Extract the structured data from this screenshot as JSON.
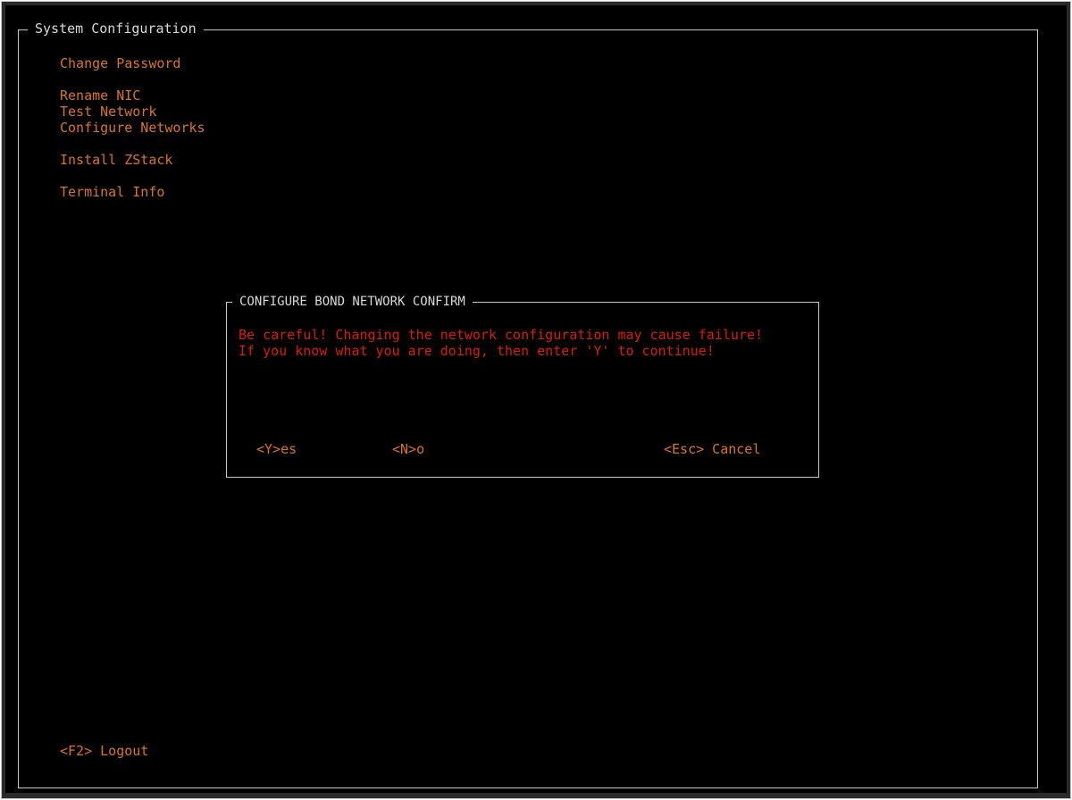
{
  "main": {
    "title": "System Configuration",
    "menu": {
      "change_password": "Change Password",
      "rename_nic": "Rename NIC",
      "test_network": "Test Network",
      "configure_networks": "Configure Networks",
      "install_zstack": "Install ZStack",
      "terminal_info": "Terminal Info"
    },
    "logout": "<F2> Logout"
  },
  "dialog": {
    "title": "CONFIGURE BOND NETWORK CONFIRM",
    "message_line1": "Be careful! Changing the network configuration may cause failure!",
    "message_line2": "If you know what you are doing, then enter 'Y' to continue!",
    "yes_label": "<Y>es",
    "no_label": "<N>o",
    "cancel_label": "<Esc> Cancel"
  },
  "colors": {
    "menu_text": "#d9741f",
    "warning_text": "#d81b0c",
    "border": "#c8c8c8",
    "background": "#000000"
  }
}
